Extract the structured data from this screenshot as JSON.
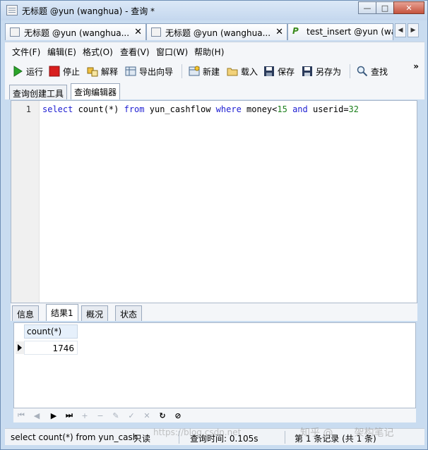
{
  "window": {
    "title": "无标题 @yun (wanghua) - 查询 *",
    "minimize": "—",
    "maximize": "□",
    "close": "✕"
  },
  "doc_tabs": [
    {
      "label": "无标题 @yun (wanghua..."
    },
    {
      "label": "无标题 @yun (wanghua..."
    },
    {
      "label": "test_insert @yun (wa"
    }
  ],
  "menu": [
    "文件(F)",
    "编辑(E)",
    "格式(O)",
    "查看(V)",
    "窗口(W)",
    "帮助(H)"
  ],
  "toolbar": {
    "run": "运行",
    "stop": "停止",
    "explain": "解释",
    "export": "导出向导",
    "new": "新建",
    "load": "载入",
    "save": "保存",
    "save_as": "另存为",
    "find": "查找",
    "more": "»"
  },
  "sub_tabs": [
    "查询创建工具",
    "查询编辑器"
  ],
  "editor": {
    "line_number": "1",
    "tokens": {
      "select": "select",
      "count": " count(*) ",
      "from": "from",
      "table": " yun_cashflow ",
      "where": "where",
      "cond1": " money<",
      "val1": "15",
      "sp": " ",
      "and": "and",
      "cond2": " userid=",
      "val2": "32"
    }
  },
  "result_tabs": [
    "信息",
    "结果1",
    "概况",
    "状态"
  ],
  "result": {
    "columns": [
      "count(*)"
    ],
    "rows": [
      [
        "1746"
      ]
    ]
  },
  "status": {
    "query": "select count(*) from yun_cash",
    "readonly": "只读",
    "time": "查询时间: 0.105s",
    "records": "第 1 条记录 (共 1 条)"
  },
  "watermark": {
    "url": "https://blog.csdn.net",
    "zhihu": "知乎 @",
    "label": "架构笔记"
  }
}
